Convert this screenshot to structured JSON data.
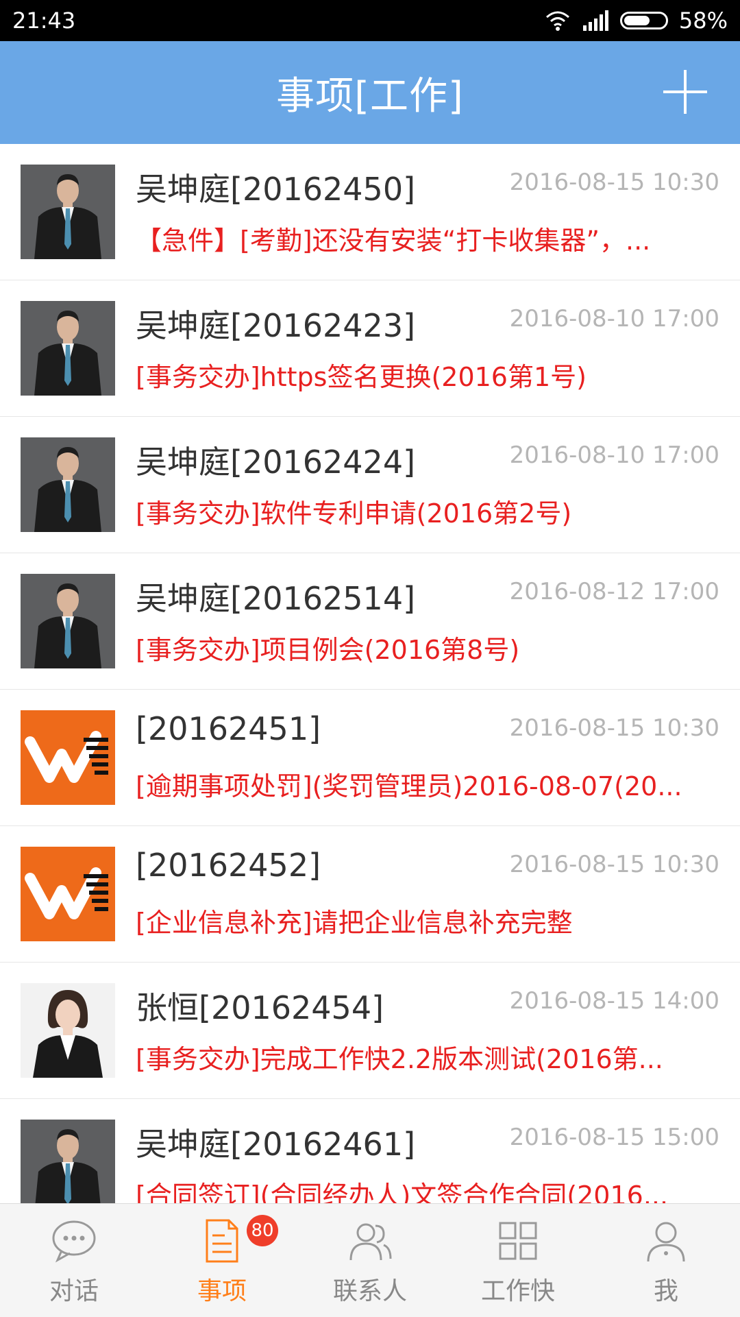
{
  "status_bar": {
    "time": "21:43",
    "battery": "58%"
  },
  "header": {
    "title": "事项[工作]"
  },
  "items": [
    {
      "name": "吴坤庭[20162450]",
      "time": "2016-08-15 10:30",
      "summary": "【急件】[考勤]还没有安装“打卡收集器”，...",
      "avatar": "man"
    },
    {
      "name": "吴坤庭[20162423]",
      "time": "2016-08-10 17:00",
      "summary": "[事务交办]https签名更换(2016第1号)",
      "avatar": "man"
    },
    {
      "name": "吴坤庭[20162424]",
      "time": "2016-08-10 17:00",
      "summary": "[事务交办]软件专利申请(2016第2号)",
      "avatar": "man"
    },
    {
      "name": "吴坤庭[20162514]",
      "time": "2016-08-12 17:00",
      "summary": "[事务交办]项目例会(2016第8号)",
      "avatar": "man"
    },
    {
      "name": "[20162451]",
      "time": "2016-08-15 10:30",
      "summary": "[逾期事项处罚](奖罚管理员)2016-08-07(20...",
      "avatar": "logo"
    },
    {
      "name": "[20162452]",
      "time": "2016-08-15 10:30",
      "summary": "[企业信息补充]请把企业信息补充完整",
      "avatar": "logo"
    },
    {
      "name": "张恒[20162454]",
      "time": "2016-08-15 14:00",
      "summary": "[事务交办]完成工作快2.2版本测试(2016第...",
      "avatar": "woman"
    },
    {
      "name": "吴坤庭[20162461]",
      "time": "2016-08-15 15:00",
      "summary": "[合同签订](合同经办人)文签合作合同(2016...",
      "avatar": "man"
    }
  ],
  "tabs": [
    {
      "label": "对话",
      "icon": "chat-icon"
    },
    {
      "label": "事项",
      "icon": "document-icon",
      "badge": "80"
    },
    {
      "label": "联系人",
      "icon": "contacts-icon"
    },
    {
      "label": "工作快",
      "icon": "grid-icon"
    },
    {
      "label": "我",
      "icon": "profile-icon"
    }
  ],
  "colors": {
    "header": "#6aa7e6",
    "accent": "#ff7f1a",
    "summary": "#e82020",
    "badge": "#ef3e2a"
  }
}
